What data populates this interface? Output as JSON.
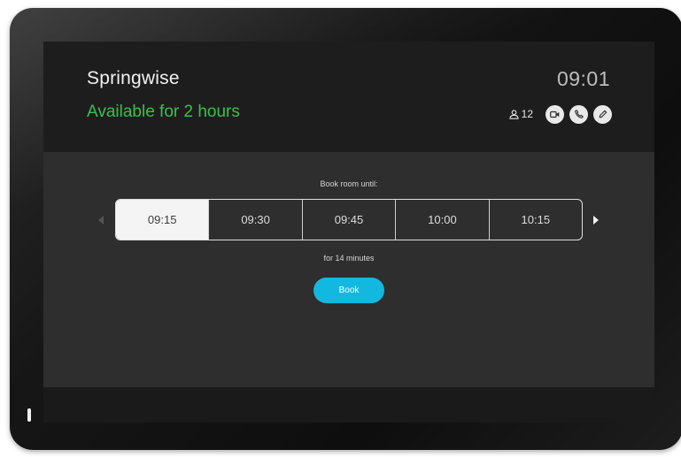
{
  "header": {
    "room_name": "Springwise",
    "availability": "Available for 2 hours",
    "clock": "09:01",
    "capacity": "12",
    "availability_color": "#35c24c"
  },
  "actions": {
    "icons": [
      "video-icon",
      "phone-icon",
      "pen-icon"
    ]
  },
  "booking": {
    "heading": "Book room until:",
    "slots": [
      {
        "label": "09:15",
        "selected": true
      },
      {
        "label": "09:30",
        "selected": false
      },
      {
        "label": "09:45",
        "selected": false
      },
      {
        "label": "10:00",
        "selected": false
      },
      {
        "label": "10:15",
        "selected": false
      }
    ],
    "duration_text": "for 14 minutes",
    "book_label": "Book",
    "accent_color": "#13b8e0"
  }
}
